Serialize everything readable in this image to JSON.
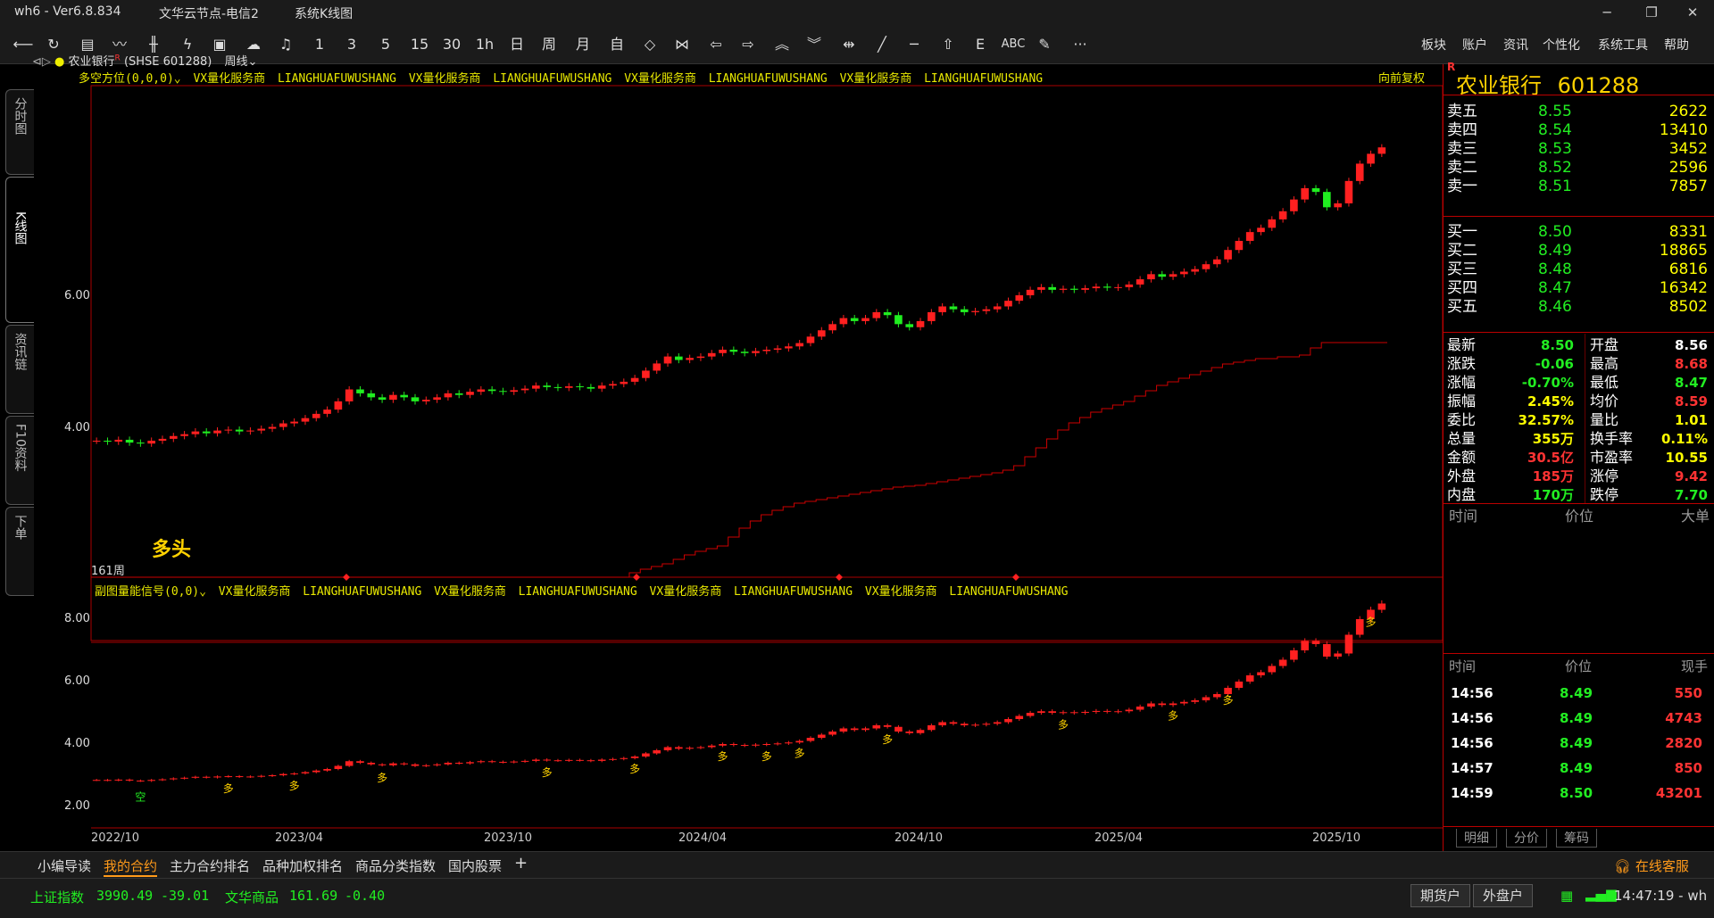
{
  "titlebar": {
    "app": "wh6 - Ver6.8.834",
    "server": "文华云节点-电信2",
    "view": "系统K线图"
  },
  "toolbar": {
    "periods": [
      "1",
      "3",
      "5",
      "15",
      "30",
      "1h",
      "日",
      "周",
      "月",
      "自"
    ],
    "abc": "ABC",
    "more": "···",
    "menus": [
      "板块",
      "账户",
      "资讯",
      "个性化",
      "系统工具",
      "帮助"
    ]
  },
  "sidetabs": [
    "分时图",
    "K线图",
    "资讯链",
    "F10资料",
    "下单"
  ],
  "chart": {
    "instrument": "农业银行",
    "flag": "R",
    "code": "(SHSE 601288)",
    "period": "周线",
    "main_indicator": "多空方位(0,0,0)",
    "sub_indicator": "副图量能信号(0,0)",
    "vendor": "VX量化服务商",
    "vendor_en": "LIANGHUAFUWUSHANG",
    "restore": "向前复权",
    "bar_count": "161周",
    "signal_label": "多头",
    "y_main": [
      "6.00",
      "4.00"
    ],
    "y_sub": [
      "8.00",
      "6.00",
      "4.00",
      "2.00"
    ],
    "x_ticks": [
      "2022/10",
      "2023/04",
      "2023/10",
      "2024/04",
      "2024/10",
      "2025/04",
      "2025/10"
    ],
    "sub_marks": {
      "duo": "多",
      "kong": "空"
    }
  },
  "chart_data": {
    "type": "candlestick",
    "series": [
      {
        "name": "农业银行",
        "values": [
          2.85,
          2.84,
          2.86,
          2.83,
          2.82,
          2.85,
          2.87,
          2.9,
          2.92,
          2.95,
          2.93,
          2.96,
          2.97,
          2.95,
          2.96,
          2.98,
          3.0,
          3.04,
          3.06,
          3.1,
          3.15,
          3.2,
          3.3,
          3.45,
          3.4,
          3.35,
          3.32,
          3.38,
          3.35,
          3.3,
          3.32,
          3.35,
          3.4,
          3.38,
          3.42,
          3.45,
          3.43,
          3.42,
          3.44,
          3.46,
          3.5,
          3.48,
          3.47,
          3.49,
          3.48,
          3.46,
          3.5,
          3.52,
          3.55,
          3.6,
          3.7,
          3.8,
          3.9,
          3.85,
          3.88,
          3.9,
          3.95,
          4.0,
          3.97,
          3.95,
          3.98,
          4.0,
          4.02,
          4.05,
          4.1,
          4.2,
          4.3,
          4.4,
          4.5,
          4.45,
          4.5,
          4.6,
          4.55,
          4.4,
          4.35,
          4.45,
          4.6,
          4.7,
          4.65,
          4.6,
          4.62,
          4.65,
          4.7,
          4.8,
          4.9,
          5.0,
          5.05,
          5.0,
          5.02,
          5.0,
          5.03,
          5.06,
          5.04,
          5.05,
          5.1,
          5.2,
          5.3,
          5.25,
          5.3,
          5.35,
          5.4,
          5.5,
          5.6,
          5.8,
          6.0,
          6.2,
          6.3,
          6.5,
          6.7,
          7.0,
          7.3,
          7.2,
          6.8,
          6.9,
          7.5,
          8.0,
          8.3,
          8.5
        ]
      }
    ],
    "y_range": [
      2.5,
      8.7
    ]
  },
  "quote": {
    "name": "农业银行",
    "code": "601288",
    "flag": "R",
    "asks": [
      {
        "label": "卖五",
        "price": "8.55",
        "vol": "2622"
      },
      {
        "label": "卖四",
        "price": "8.54",
        "vol": "13410"
      },
      {
        "label": "卖三",
        "price": "8.53",
        "vol": "3452"
      },
      {
        "label": "卖二",
        "price": "8.52",
        "vol": "2596"
      },
      {
        "label": "卖一",
        "price": "8.51",
        "vol": "7857"
      }
    ],
    "bids": [
      {
        "label": "买一",
        "price": "8.50",
        "vol": "8331"
      },
      {
        "label": "买二",
        "price": "8.49",
        "vol": "18865"
      },
      {
        "label": "买三",
        "price": "8.48",
        "vol": "6816"
      },
      {
        "label": "买四",
        "price": "8.47",
        "vol": "16342"
      },
      {
        "label": "买五",
        "price": "8.46",
        "vol": "8502"
      }
    ],
    "stats": [
      {
        "l1": "最新",
        "v1": "8.50",
        "c1": "#22ee22",
        "l2": "开盘",
        "v2": "8.56",
        "c2": "#ffffff"
      },
      {
        "l1": "涨跌",
        "v1": "-0.06",
        "c1": "#22ee22",
        "l2": "最高",
        "v2": "8.68",
        "c2": "#ff3333"
      },
      {
        "l1": "涨幅",
        "v1": "-0.70%",
        "c1": "#22ee22",
        "l2": "最低",
        "v2": "8.47",
        "c2": "#22ee22"
      },
      {
        "l1": "振幅",
        "v1": "2.45%",
        "c1": "#ffff00",
        "l2": "均价",
        "v2": "8.59",
        "c2": "#ff3333"
      },
      {
        "l1": "委比",
        "v1": "32.57%",
        "c1": "#ffff00",
        "l2": "量比",
        "v2": "1.01",
        "c2": "#ffff00"
      },
      {
        "l1": "总量",
        "v1": "355万",
        "c1": "#ffff00",
        "l2": "换手率",
        "v2": "0.11%",
        "c2": "#ffff00"
      },
      {
        "l1": "金额",
        "v1": "30.5亿",
        "c1": "#ff3333",
        "l2": "市盈率",
        "v2": "10.55",
        "c2": "#ffff00"
      },
      {
        "l1": "外盘",
        "v1": "185万",
        "c1": "#ff3333",
        "l2": "涨停",
        "v2": "9.42",
        "c2": "#ff3333"
      },
      {
        "l1": "内盘",
        "v1": "170万",
        "c1": "#22ee22",
        "l2": "跌停",
        "v2": "7.70",
        "c2": "#22ee22"
      }
    ],
    "big_header": [
      "时间",
      "价位",
      "大单"
    ],
    "tick_header": [
      "时间",
      "价位",
      "现手"
    ],
    "ticks": [
      {
        "t": "14:56",
        "p": "8.49",
        "v": "550"
      },
      {
        "t": "14:56",
        "p": "8.49",
        "v": "4743"
      },
      {
        "t": "14:56",
        "p": "8.49",
        "v": "2820"
      },
      {
        "t": "14:57",
        "p": "8.49",
        "v": "850"
      },
      {
        "t": "14:59",
        "p": "8.50",
        "v": "43201"
      }
    ],
    "tabs": [
      "明细",
      "分价",
      "筹码"
    ]
  },
  "bottomtabs": [
    "小编导读",
    "我的合约",
    "主力合约排名",
    "品种加权排名",
    "商品分类指数",
    "国内股票"
  ],
  "status": {
    "idx1_name": "上证指数",
    "idx1_val": "3990.49",
    "idx1_chg": "-39.01",
    "idx2_name": "文华商品",
    "idx2_val": "161.69",
    "idx2_chg": "-0.40",
    "btn1": "期货户",
    "btn2": "外盘户",
    "time": "14:47:19 - wh",
    "service": "在线客服"
  }
}
